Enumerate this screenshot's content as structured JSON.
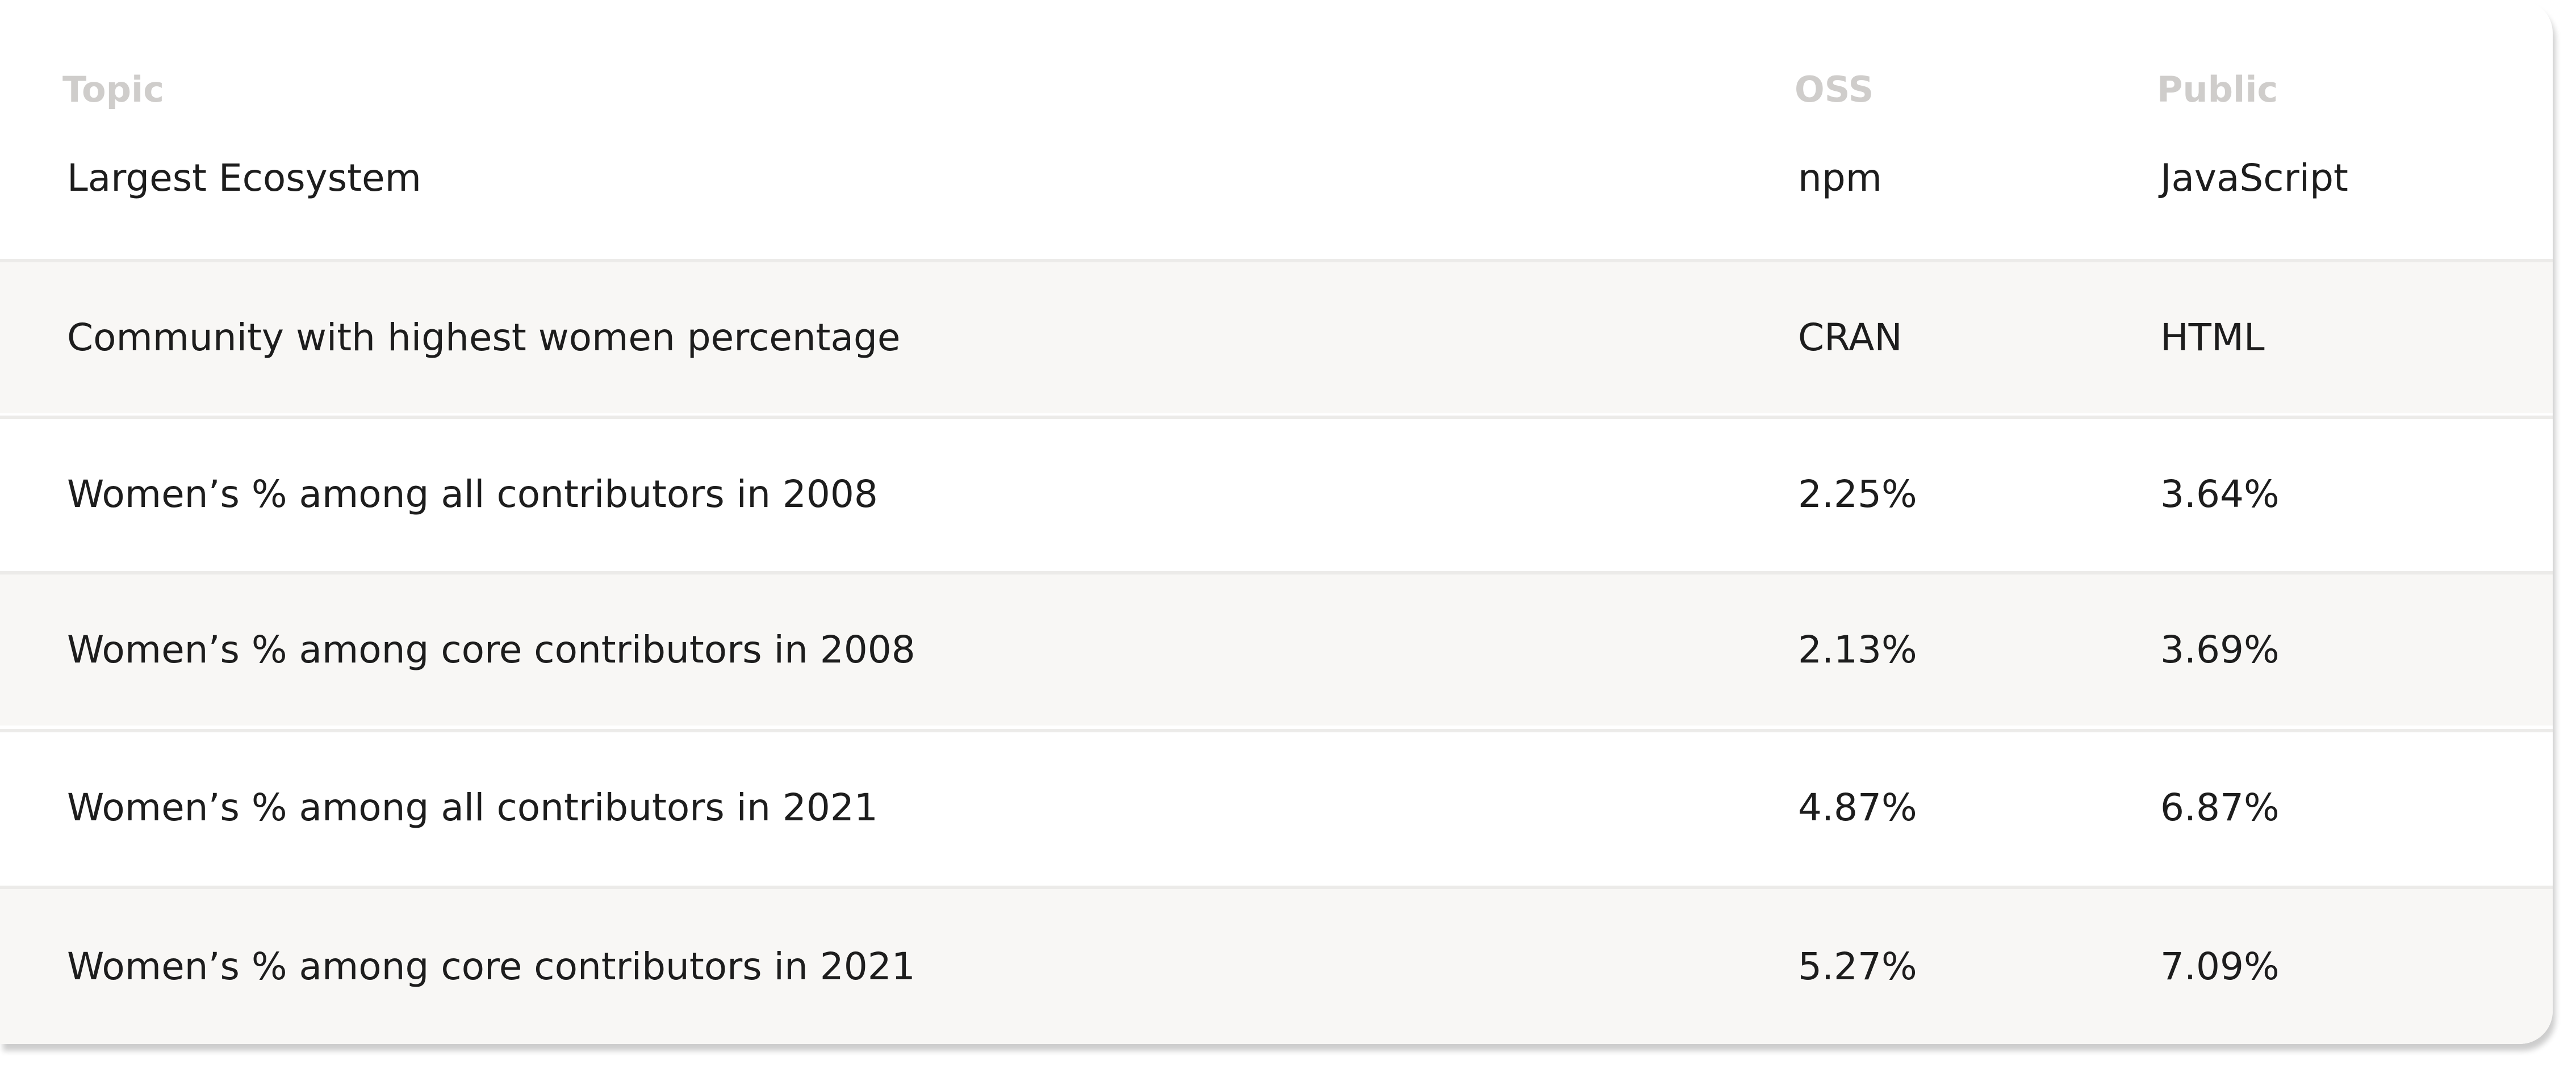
{
  "table": {
    "headers": {
      "topic": "Topic",
      "oss": "OSS",
      "public": "Public"
    },
    "rows": [
      {
        "topic": "Largest Ecosystem",
        "oss": "npm",
        "public": "JavaScript"
      },
      {
        "topic": "Community with highest women percentage",
        "oss": "CRAN",
        "public": "HTML"
      },
      {
        "topic": "Women’s % among all contributors in 2008",
        "oss": "2.25%",
        "public": "3.64%"
      },
      {
        "topic": "Women’s % among core contributors in 2008",
        "oss": "2.13%",
        "public": "3.69%"
      },
      {
        "topic": "Women’s % among all contributors in 2021",
        "oss": "4.87%",
        "public": "6.87%"
      },
      {
        "topic": "Women’s % among core contributors in 2021",
        "oss": "5.27%",
        "public": "7.09%"
      }
    ]
  },
  "colors": {
    "header_text": "#cfcdcb",
    "body_text": "#1d1d1d",
    "alt_row_bg": "#f8f7f5",
    "divider": "#ecebe9"
  }
}
